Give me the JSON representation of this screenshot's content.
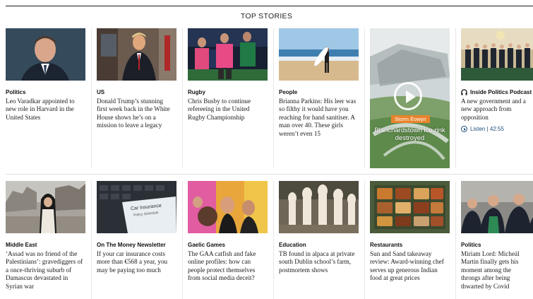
{
  "section": {
    "title": "TOP STORIES"
  },
  "row1": [
    {
      "category": "Politics",
      "headline": "Leo Varadkar appointed to new role in Harvard in the United States"
    },
    {
      "category": "US",
      "headline": "Donald Trump’s stunning first week back in the White House shows he’s on a mission to leave a legacy"
    },
    {
      "category": "Rugby",
      "headline": "Chris Busby to continue refereeing in the United Rugby Championship"
    },
    {
      "category": "People",
      "headline": "Brianna Parkins: His leer was so filthy it would have you reaching for hand sanitiser. A man over 40. These girls weren’t even 15"
    }
  ],
  "video": {
    "tag": "Storm Éowyn",
    "caption": "Blanchardstown ice rink destroyed"
  },
  "podcast": {
    "label": "Inside Politics Podcast",
    "headline": "A new government and a new approach from opposition",
    "listen": "Listen | 42:55"
  },
  "row2": [
    {
      "category": "Middle East",
      "headline": "‘Assad was no friend of the Palestinians’: gravediggers of a once-thriving suburb of Damascus devastated in Syrian war"
    },
    {
      "category": "On The Money Newsletter",
      "headline": "If your car insurance costs more than €568 a year, you may be paying too much"
    },
    {
      "category": "Gaelic Games",
      "headline": "The GAA catfish and fake online profiles: how can people protect themselves from social media deceit?"
    },
    {
      "category": "Education",
      "headline": "TB found in alpaca at private south Dublin school’s farm, postmortem shows"
    },
    {
      "category": "Restaurants",
      "headline": "Sun and Sand takeaway review: Award-winning chef serves up generous Indian food at great prices"
    },
    {
      "category": "Politics",
      "headline": "Miriam Lord: Micheál Martin finally gets his moment among the throngs after being thwarted by Covid"
    }
  ],
  "images": {
    "insurance_card_line1": "Car Insurance",
    "insurance_card_line2": "Policy Schedule"
  },
  "colors": {
    "accent": "#1f4e79",
    "storm_tag": "#e8842c"
  }
}
